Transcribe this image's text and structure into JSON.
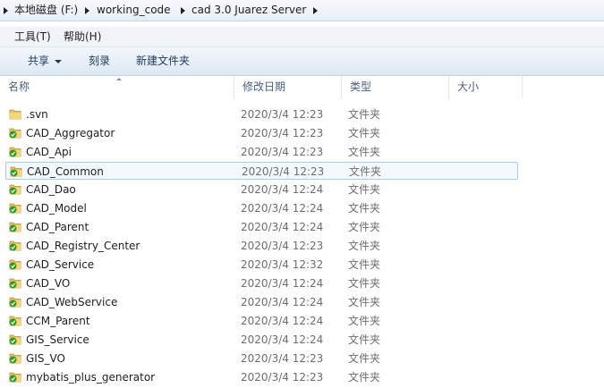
{
  "breadcrumb": {
    "items": [
      "本地磁盘 (F:)",
      "working_code",
      "cad 3.0 Juarez Server"
    ]
  },
  "menu": {
    "tools": "工具(T)",
    "help": "帮助(H)"
  },
  "toolbar": {
    "share": "共享",
    "burn": "刻录",
    "new_folder": "新建文件夹"
  },
  "columns": {
    "name": "名称",
    "modified": "修改日期",
    "type": "类型",
    "size": "大小"
  },
  "files": [
    {
      "name": ".svn",
      "date": "2020/3/4 12:23",
      "type": "文件夹",
      "icon": "folder-icon"
    },
    {
      "name": "CAD_Aggregator",
      "date": "2020/3/4 12:23",
      "type": "文件夹",
      "icon": "svn-folder-icon"
    },
    {
      "name": "CAD_Api",
      "date": "2020/3/4 12:23",
      "type": "文件夹",
      "icon": "svn-folder-icon"
    },
    {
      "name": "CAD_Common",
      "date": "2020/3/4 12:23",
      "type": "文件夹",
      "icon": "svn-folder-icon",
      "selected": true
    },
    {
      "name": "CAD_Dao",
      "date": "2020/3/4 12:24",
      "type": "文件夹",
      "icon": "svn-folder-icon"
    },
    {
      "name": "CAD_Model",
      "date": "2020/3/4 12:24",
      "type": "文件夹",
      "icon": "svn-folder-icon"
    },
    {
      "name": "CAD_Parent",
      "date": "2020/3/4 12:24",
      "type": "文件夹",
      "icon": "svn-folder-icon"
    },
    {
      "name": "CAD_Registry_Center",
      "date": "2020/3/4 12:23",
      "type": "文件夹",
      "icon": "svn-folder-icon"
    },
    {
      "name": "CAD_Service",
      "date": "2020/3/4 12:32",
      "type": "文件夹",
      "icon": "svn-folder-icon"
    },
    {
      "name": "CAD_VO",
      "date": "2020/3/4 12:24",
      "type": "文件夹",
      "icon": "svn-folder-icon"
    },
    {
      "name": "CAD_WebService",
      "date": "2020/3/4 12:24",
      "type": "文件夹",
      "icon": "svn-folder-icon"
    },
    {
      "name": "CCM_Parent",
      "date": "2020/3/4 12:24",
      "type": "文件夹",
      "icon": "svn-folder-icon"
    },
    {
      "name": "GIS_Service",
      "date": "2020/3/4 12:24",
      "type": "文件夹",
      "icon": "svn-folder-icon"
    },
    {
      "name": "GIS_VO",
      "date": "2020/3/4 12:23",
      "type": "文件夹",
      "icon": "svn-folder-icon"
    },
    {
      "name": "mybatis_plus_generator",
      "date": "2020/3/4 12:23",
      "type": "文件夹",
      "icon": "svn-folder-icon"
    }
  ],
  "colors": {
    "svn_check": "#2f9a1f",
    "folder": "#e8c25a",
    "selection_border": "#aacbeb"
  }
}
